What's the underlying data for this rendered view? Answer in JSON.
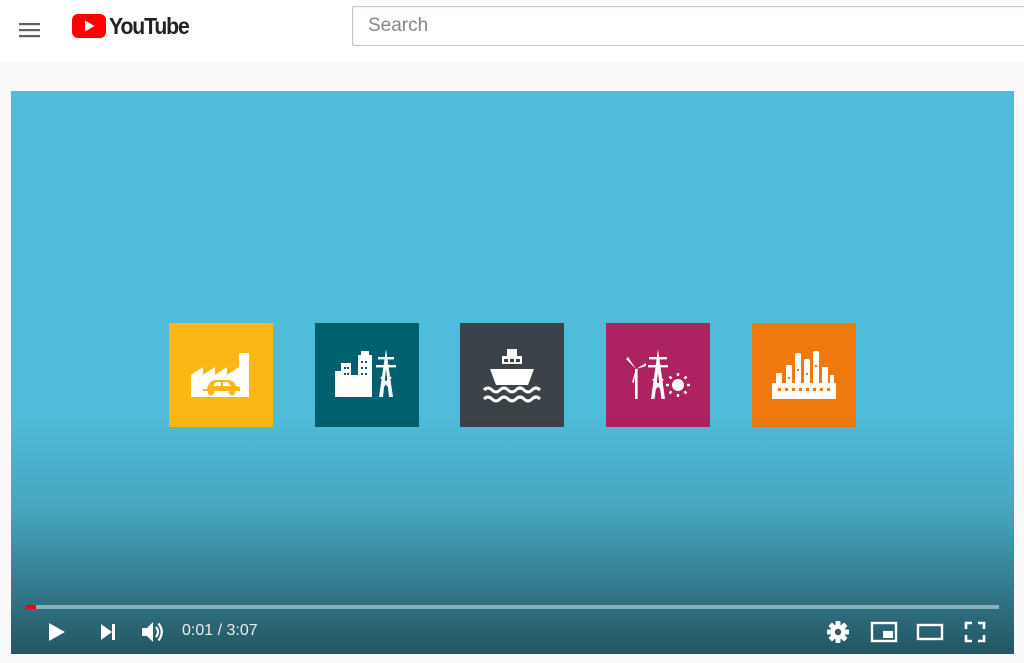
{
  "masthead": {
    "logo_text": "YouTube",
    "logo_color": "#ff0000",
    "search": {
      "placeholder": "Search",
      "value": ""
    }
  },
  "player": {
    "background_color": "#4fbcd9",
    "tiles": [
      {
        "icon": "factory-car-icon",
        "color": "#fdb714"
      },
      {
        "icon": "city-powerline-icon",
        "color": "#00606e"
      },
      {
        "icon": "ship-icon",
        "color": "#3b4348"
      },
      {
        "icon": "wind-solar-pylon-icon",
        "color": "#ad2260"
      },
      {
        "icon": "refinery-icon",
        "color": "#ee7a0e"
      }
    ],
    "progress": {
      "played_fraction": 0.005,
      "loaded_fraction": 0.0
    },
    "current_time": "0:01",
    "duration": "3:07",
    "time_separator": " / ",
    "controls": [
      "play-icon",
      "next-icon",
      "volume-icon",
      "settings-icon",
      "miniplayer-icon",
      "theater-mode-icon",
      "fullscreen-icon"
    ]
  }
}
